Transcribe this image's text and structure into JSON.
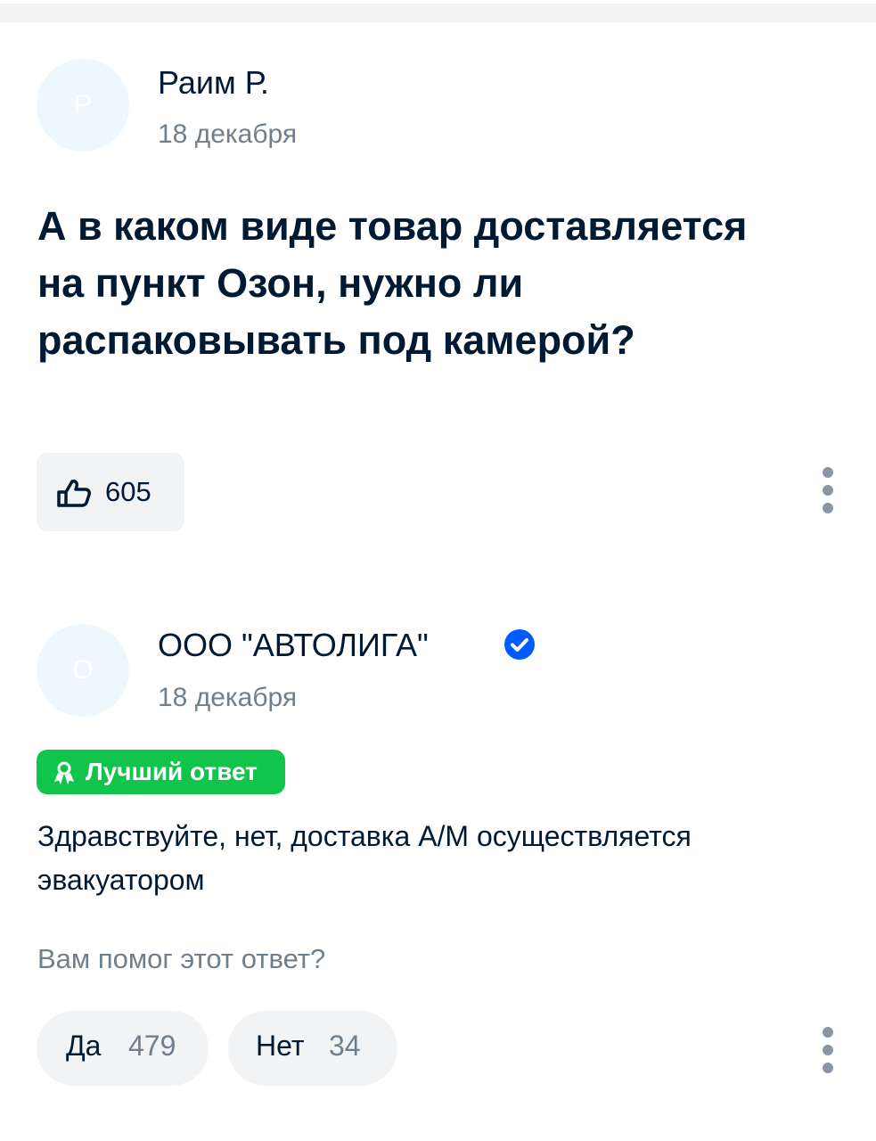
{
  "question_post": {
    "avatar_letter": "Р",
    "author": "Раим Р.",
    "date": "18 декабря",
    "text": "А в каком виде товар доставляется на пункт Озон, нужно ли распаковывать под камерой?",
    "likes": "605",
    "like_icon": "thumbs-up-icon",
    "menu_icon": "more-vertical-icon"
  },
  "answer_post": {
    "avatar_letter": "О",
    "author": "ООО \"АВТОЛИГА\"",
    "verified_icon": "verified-check-icon",
    "date": "18 декабря",
    "best_badge": "Лучший ответ",
    "best_badge_icon": "award-icon",
    "text": "Здравствуйте, нет, доставка А/М осуществляется эвакуатором",
    "helpful_prompt": "Вам помог этот ответ?",
    "yes_label": "Да",
    "yes_count": "479",
    "no_label": "Нет",
    "no_count": "34",
    "menu_icon": "more-vertical-icon"
  },
  "colors": {
    "text": "#001a34",
    "secondary_text": "#707f8d",
    "best_badge": "#10c44c",
    "verified": "#005bff",
    "button_bg": "#f2f3f5",
    "avatar_bg": "#eef7fd"
  }
}
